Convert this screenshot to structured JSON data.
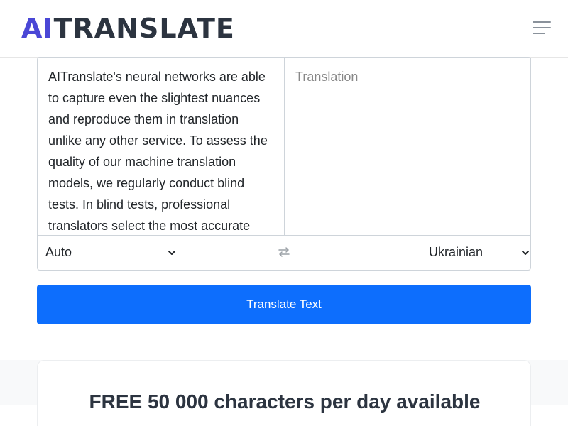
{
  "header": {
    "logo_ai": "AI",
    "logo_rest": "TRANSLATE",
    "menu_icon": "hamburger-menu-icon"
  },
  "translator": {
    "source_text": "AITranslate's neural networks are able to capture even the slightest nuances and reproduce them in translation unlike any other service. To assess the quality of our machine translation models, we regularly conduct blind tests. In blind tests, professional translators select the most accurate",
    "target_placeholder": "Translation",
    "source_language": "Auto",
    "target_language": "Ukrainian",
    "swap_icon": "swap-arrows-icon"
  },
  "actions": {
    "translate_label": "Translate Text"
  },
  "promo": {
    "title": "FREE 50 000 characters per day available"
  },
  "colors": {
    "brand_accent": "#4a47d6",
    "primary_button": "#0d6efd",
    "logo_dark": "#2c3440"
  }
}
